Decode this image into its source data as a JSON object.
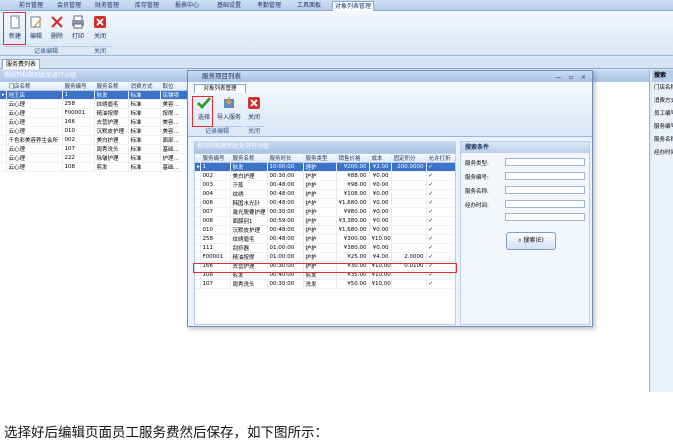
{
  "menu": [
    "前台管理",
    "会员管理",
    "财务管理",
    "库存管理",
    "报表中心",
    "基础设置",
    "考勤管理",
    "工具面板",
    "对象列表管理"
  ],
  "toolbar": {
    "new_label": "新建",
    "edit_label": "编辑",
    "delete_label": "删除",
    "print_label": "打印",
    "close_label": "关闭",
    "group_edit": "记录编辑",
    "group_close": "关闭"
  },
  "doc_tab": "服务费列表",
  "main": {
    "panel_header": "拖动列标题到此处进行分组",
    "columns": [
      "门店名称",
      "服务编号",
      "服务名称",
      "消费方式",
      "取位"
    ],
    "rows": [
      [
        "地王店",
        "1",
        "狄发",
        "标准",
        "店铺项"
      ],
      [
        "云心理",
        "258",
        "纹绣眉毛",
        "标准",
        "美容…"
      ],
      [
        "云心理",
        "F00001",
        "精油按摩",
        "标准",
        "按摩…"
      ],
      [
        "云心理",
        "166",
        "去营护理",
        "标准",
        "美容…"
      ],
      [
        "云心理",
        "010",
        "沉默皮护理",
        "标准",
        "美容…"
      ],
      [
        "千色彩美容养生会所",
        "002",
        "美白护理",
        "标准",
        "面部…"
      ],
      [
        "云心理",
        "107",
        "周秀洗头",
        "标准",
        "基础…"
      ],
      [
        "云心理",
        "222",
        "除皱护理",
        "标准",
        "护理…"
      ],
      [
        "云心理",
        "108",
        "剪发",
        "标准",
        "基础…"
      ]
    ]
  },
  "right_panel": {
    "title": "搜索",
    "items": [
      "门店名称",
      "消费方式",
      "员工编号",
      "服务编号",
      "服务名称",
      "经办时间"
    ]
  },
  "dialog": {
    "title": "服务项目列表",
    "window_buttons": "— ▫ ×",
    "tab": "对象列表管理",
    "select_label": "选择",
    "import_label": "导入服务",
    "close_label": "关闭",
    "group_edit": "记录编辑",
    "group_close": "关闭",
    "grid_header": "拖动列标题到此处进行分组",
    "columns": [
      "服务编号",
      "服务名称",
      "服务时长",
      "服务类型",
      "销售价格",
      "成本",
      "固定积分",
      "允许打折"
    ],
    "rows": [
      [
        "1",
        "狄发",
        "10:00:00",
        "理护",
        "¥200.00",
        "¥2.00",
        "200.0000",
        "✓"
      ],
      [
        "002",
        "美白护理",
        "00:30:00",
        "护护",
        "¥88.00",
        "¥0.00",
        "",
        "✓"
      ],
      [
        "003",
        "汗蒸",
        "00:48:00",
        "护护",
        "¥98.00",
        "¥0.00",
        "",
        "✓"
      ],
      [
        "004",
        "纹绣",
        "00:48:00",
        "护护",
        "¥108.00",
        "¥0.00",
        "",
        "✓"
      ],
      [
        "006",
        "韩国水光针",
        "00:48:00",
        "护护",
        "¥1,680.00",
        "¥0.00",
        "",
        "✓"
      ],
      [
        "007",
        "激光脱要护理",
        "00:30:00",
        "护护",
        "¥980.00",
        "¥0.00",
        "",
        "✓"
      ],
      [
        "008",
        "面膜别1",
        "00:59:00",
        "护护",
        "¥3,380.00",
        "¥0.00",
        "",
        "✓"
      ],
      [
        "010",
        "沉默皮护理",
        "00:48:00",
        "护护",
        "¥1,680.00",
        "¥0.00",
        "",
        "✓"
      ],
      [
        "258",
        "纹绣眉毛",
        "00:48:00",
        "护护",
        "¥300.00",
        "¥10.00",
        "",
        "✓"
      ],
      [
        "111",
        "刮痧器",
        "01:00:00",
        "护护",
        "¥380.00",
        "¥0.00",
        "",
        "✓"
      ],
      [
        "F00001",
        "精油按摩",
        "01:00:00",
        "护护",
        "¥25.00",
        "¥4.00",
        "2.0000",
        "✓"
      ],
      [
        "166",
        "去营护理",
        "00:30:00",
        "护护",
        "¥30.00",
        "¥10.00",
        "0.0100",
        "✓"
      ],
      [
        "108",
        "剪发",
        "00:40:00",
        "剪发",
        "¥35.00",
        "¥10.00",
        "",
        "✓"
      ],
      [
        "107",
        "周秀洗头",
        "00:30:00",
        "洗发",
        "¥50.00",
        "¥10.00",
        "",
        "✓"
      ]
    ]
  },
  "search": {
    "title": "搜索条件",
    "labels": [
      "服务类型:",
      "服务编号:",
      "服务名称:",
      "经办时间:"
    ],
    "button": "搜索(E)"
  },
  "caption": "选择好后编辑页面员工服务费然后保存，如下图所示：",
  "colors": {
    "selection": "#3b73c8",
    "highlight_box": "#e03030",
    "accent": "#8aa8d0"
  }
}
